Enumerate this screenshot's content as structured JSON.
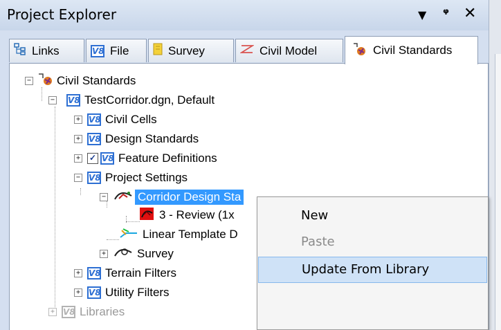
{
  "panel": {
    "title": "Project Explorer",
    "icons": [
      "dropdown-arrow-icon",
      "pin-icon",
      "close-icon"
    ]
  },
  "tabs": [
    {
      "label": "Links",
      "icon": "links-icon"
    },
    {
      "label": "File",
      "icon": "v8-icon"
    },
    {
      "label": "Survey",
      "icon": "survey-icon"
    },
    {
      "label": "Civil Model",
      "icon": "civil-model-icon"
    },
    {
      "label": "Civil Standards",
      "icon": "civil-standards-icon",
      "active": true
    }
  ],
  "tree": {
    "root": "Civil Standards",
    "file": "TestCorridor.dgn, Default",
    "civil_cells": "Civil Cells",
    "design_standards": "Design Standards",
    "feature_definitions": "Feature Definitions",
    "project_settings": "Project Settings",
    "corridor_design_stages": "Corridor Design Sta",
    "review": "3 - Review (1x",
    "linear_template": "Linear Template D",
    "survey": "Survey",
    "terrain_filters": "Terrain Filters",
    "utility_filters": "Utility Filters",
    "libraries": "Libraries"
  },
  "context_menu": {
    "items": [
      {
        "label": "New",
        "enabled": true
      },
      {
        "label": "Paste",
        "enabled": false
      },
      {
        "label": "Update From Library",
        "enabled": true,
        "highlighted": true
      }
    ]
  },
  "colors": {
    "selection": "#3399ff",
    "v8_blue": "#2d6fd3",
    "menu_hover": "#cfe2f7"
  }
}
